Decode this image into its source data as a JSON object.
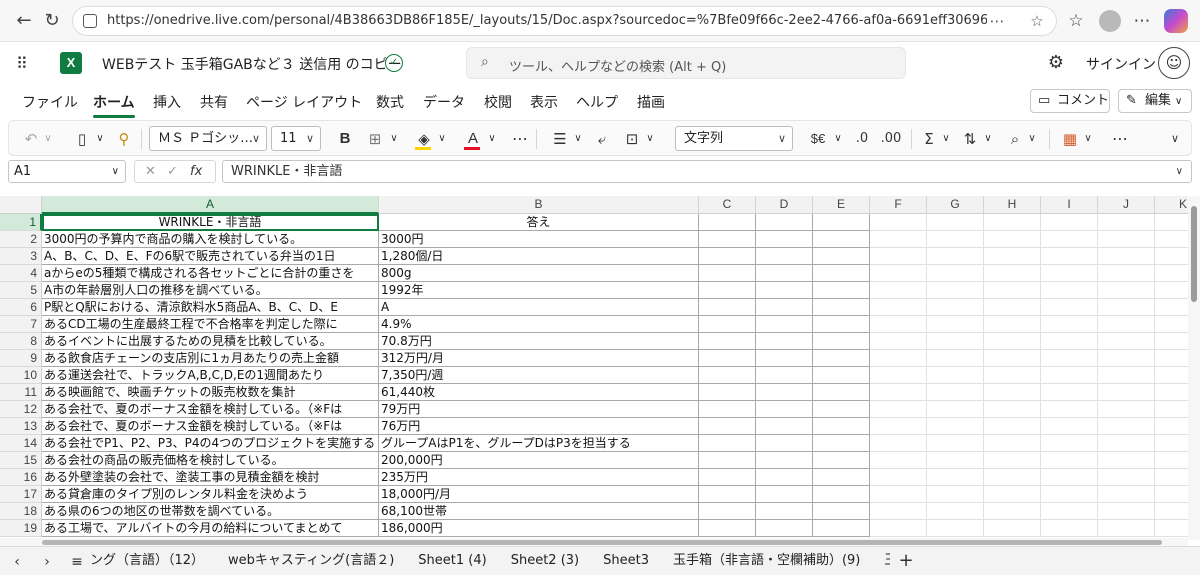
{
  "browser": {
    "url": "https://onedrive.live.com/personal/4B38663DB86F185E/_layouts/15/Doc.aspx?sourcedoc=%7Bfe09f66c-2ee2-4766-af0a-6691eff30696%7D&action=...",
    "back_icon": "arrow-left-icon",
    "reload_icon": "reload-icon"
  },
  "app": {
    "logo": "X",
    "title": "WEBテスト 玉手箱GABなど３ 送信用 のコピー",
    "search_placeholder": "ツール、ヘルプなどの検索 (Alt + Q)",
    "signin_label": "サインイン"
  },
  "ribbon": {
    "tabs": [
      "ファイル",
      "ホーム",
      "挿入",
      "共有",
      "ページ レイアウト",
      "数式",
      "データ",
      "校閲",
      "表示",
      "ヘルプ",
      "描画"
    ],
    "active_tab": "ホーム",
    "comment_label": "コメント",
    "edit_label": "編集"
  },
  "toolbar": {
    "font_name": "ＭＳ Ｐゴシッ…",
    "font_size": "11",
    "number_format": "文字列",
    "bold_label": "B",
    "currency_label": "$€",
    "font_color": "#e81123",
    "fill_color": "#ffd400"
  },
  "formula_bar": {
    "name_box": "A1",
    "fx_label": "fx",
    "content": "WRINKLE・非言語"
  },
  "sheet": {
    "columns": [
      "A",
      "B",
      "C",
      "D",
      "E",
      "F",
      "G",
      "H",
      "I",
      "J",
      "K"
    ],
    "selected_column": "A",
    "rows": [
      {
        "n": "1",
        "a": "WRINKLE・非言語",
        "b": "答え"
      },
      {
        "n": "2",
        "a": "3000円の予算内で商品の購入を検討している。",
        "b": "3000円"
      },
      {
        "n": "3",
        "a": "A、B、C、D、E、Fの6駅で販売されている弁当の1日",
        "b": "1,280個/日"
      },
      {
        "n": "4",
        "a": "aからeの5種類で構成される各セットごとに合計の重さを",
        "b": "800g"
      },
      {
        "n": "5",
        "a": "A市の年齢層別人口の推移を調べている。",
        "b": "1992年"
      },
      {
        "n": "6",
        "a": "P駅とQ駅における、清涼飲料水5商品A、B、C、D、E",
        "b": "A"
      },
      {
        "n": "7",
        "a": "あるCD工場の生産最終工程で不合格率を判定した際に",
        "b": "4.9%"
      },
      {
        "n": "8",
        "a": "あるイベントに出展するための見積を比較している。",
        "b": "70.8万円"
      },
      {
        "n": "9",
        "a": "ある飲食店チェーンの支店別に1ヵ月あたりの売上金額",
        "b": "312万円/月"
      },
      {
        "n": "10",
        "a": "ある運送会社で、トラックA,B,C,D,Eの1週間あたり",
        "b": "7,350円/週"
      },
      {
        "n": "11",
        "a": "ある映画館で、映画チケットの販売枚数を集計",
        "b": "61,440枚"
      },
      {
        "n": "12",
        "a": "ある会社で、夏のボーナス金額を検討している。（※Fは",
        "b": "79万円"
      },
      {
        "n": "13",
        "a": "ある会社で、夏のボーナス金額を検討している。（※Fは",
        "b": "76万円"
      },
      {
        "n": "14",
        "a": "ある会社でP1、P2、P3、P4の4つのプロジェクトを実施する",
        "b": "グループAはP1を、グループDはP3を担当する"
      },
      {
        "n": "15",
        "a": "ある会社の商品の販売価格を検討している。",
        "b": "200,000円"
      },
      {
        "n": "16",
        "a": "ある外壁塗装の会社で、塗装工事の見積金額を検討",
        "b": "235万円"
      },
      {
        "n": "17",
        "a": "ある貸倉庫のタイプ別のレンタル料金を決めよう",
        "b": "18,000円/月"
      },
      {
        "n": "18",
        "a": "ある県の6つの地区の世帯数を調べている。",
        "b": "68,100世帯"
      },
      {
        "n": "19",
        "a": "ある工場で、アルバイトの今月の給料についてまとめて",
        "b": "186,000円"
      }
    ]
  },
  "sheet_tabs": [
    "ング（言語）（12）",
    "webキャスティング(言語２)",
    "Sheet1 (4)",
    "Sheet2 (3)",
    "Sheet3",
    "玉手箱（非言語・空欄補助）(9)",
    "玉手箱（非言"
  ],
  "accent_color": "#107c41"
}
